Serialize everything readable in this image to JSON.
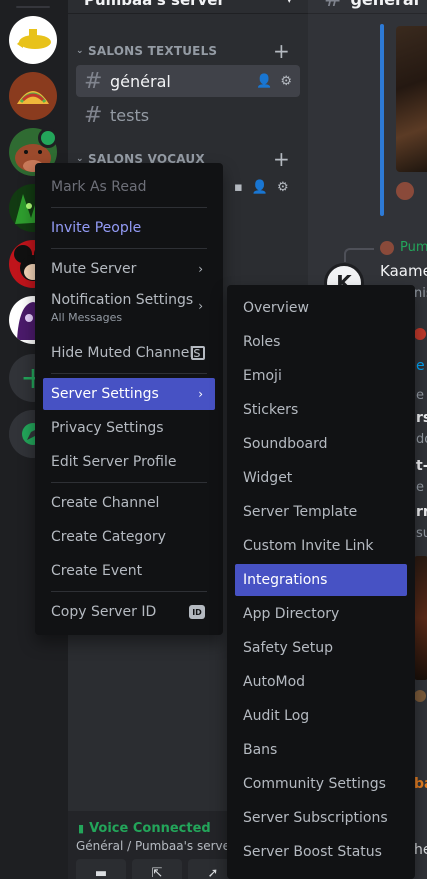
{
  "server": {
    "name": "Pumbaa's server",
    "header_chevron": "chevron-down-icon"
  },
  "rail": {
    "servers": [
      {
        "icon": "yellow-submarine-icon"
      },
      {
        "icon": "taco-icon"
      },
      {
        "icon": "warthog-icon",
        "speaking": true
      },
      {
        "icon": "green-creature-icon"
      },
      {
        "icon": "mickey-icon"
      },
      {
        "icon": "purple-character-icon"
      }
    ],
    "add_label": "+",
    "discover_icon": "compass-icon"
  },
  "sidebar": {
    "cat_text": "SALONS TEXTUELS",
    "cat_voice": "SALONS VOCAUX",
    "channels": [
      {
        "name": "général",
        "active": true
      },
      {
        "name": "tests",
        "active": false
      }
    ]
  },
  "voice": {
    "status": "Voice Connected",
    "location": "Général / Pumbaa's server"
  },
  "chat": {
    "channel": "général",
    "peeks": {
      "p1": "Pumb",
      "p2": "Kaame",
      "p3": "nis",
      "p4": "e",
      "p5": "e",
      "p6": "rs",
      "p7": "do",
      "p8": "t-",
      "p9": "e",
      "p10": "rn",
      "p11": "su",
      "p12": "ba",
      "p13": "he"
    }
  },
  "context_menu": {
    "items": [
      {
        "label": "Mark As Read"
      },
      {
        "label": "Invite People"
      },
      {
        "label": "Mute Server"
      },
      {
        "label": "Notification Settings",
        "sub": "All Messages"
      },
      {
        "label": "Hide Muted Channels"
      },
      {
        "label": "Server Settings"
      },
      {
        "label": "Privacy Settings"
      },
      {
        "label": "Edit Server Profile"
      },
      {
        "label": "Create Channel"
      },
      {
        "label": "Create Category"
      },
      {
        "label": "Create Event"
      },
      {
        "label": "Copy Server ID",
        "badge": "ID"
      }
    ]
  },
  "settings_menu": {
    "items": [
      "Overview",
      "Roles",
      "Emoji",
      "Stickers",
      "Soundboard",
      "Widget",
      "Server Template",
      "Custom Invite Link",
      "Integrations",
      "App Directory",
      "Safety Setup",
      "AutoMod",
      "Audit Log",
      "Bans",
      "Community Settings",
      "Server Subscriptions",
      "Server Boost Status"
    ],
    "highlighted": "Integrations"
  },
  "colors": {
    "accent": "#4752c4",
    "online": "#23a55a",
    "menu_bg": "#111214"
  }
}
